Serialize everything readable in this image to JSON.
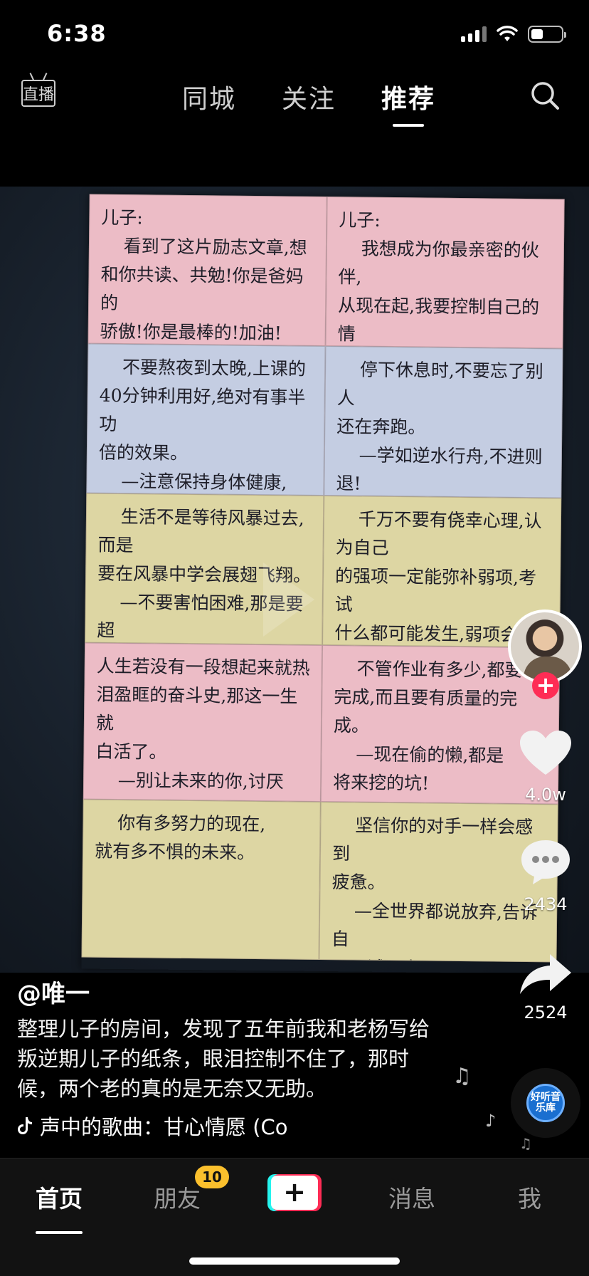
{
  "status_bar": {
    "time": "6:38"
  },
  "top_nav": {
    "live_label": "直播",
    "tabs": [
      {
        "label": "同城",
        "active": false
      },
      {
        "label": "关注",
        "active": false
      },
      {
        "label": "推荐",
        "active": true
      }
    ]
  },
  "video": {
    "notes": [
      {
        "text": "儿子:\n    看到了这片励志文章,想\n和你共读、共勉!你是爸妈的\n骄傲!你是最棒的!加油!"
      },
      {
        "text": "儿子:\n    我想成为你最亲密的伙伴,\n从现在起,我要控制自己的情\n绪,和你一起安静和平的处理\n好每一个当下。"
      },
      {
        "text": "    不要熬夜到太晚,上课的\n40分钟利用好,绝对有事半功\n倍的效果。\n    —注意保持身体健康,\n提高学习效率!"
      },
      {
        "text": "    停下休息时,不要忘了别人\n还在奔跑。\n    —学如逆水行舟,不进则\n退!"
      },
      {
        "text": "    生活不是等待风暴过去,而是\n要在风暴中学会展翅飞翔。\n    —不要害怕困难,那是要超\n越别人的机会!"
      },
      {
        "text": "    千万不要有侥幸心理,认为自己\n的强项一定能弥补弱项,考试\n什么都可能发生,弱项会使你来到\n失败!\n    —优秀和平庸的差距\n只在于一件事!"
      },
      {
        "text": "人生若没有一段想起来就热\n泪盈眶的奋斗史,那这一生就\n白活了。\n    —别让未来的你,讨厌\n现在的自己!"
      },
      {
        "text": "    不管作业有多少,都要\n完成,而且要有质量的完成。\n    —现在偷的懒,都是\n将来挖的坑!"
      },
      {
        "text": "    你有多努力的现在,\n就有多不惧的未来。"
      },
      {
        "text": "    坚信你的对手一样会感到\n疲惫。\n    —全世界都说放弃,告诉自\n己再试一次!"
      }
    ]
  },
  "actions": {
    "follow_symbol": "+",
    "likes": "4.0w",
    "comments": "2434",
    "shares": "2524"
  },
  "post": {
    "author": "@唯一",
    "caption": "整理儿子的房间，发现了五年前我和老杨写给叛逆期儿子的纸条，眼泪控制不住了，那时候，两个老的真的是无奈又无助。",
    "music": "声中的歌曲：甘心情愿 (Co",
    "disc_text": "好听音乐库"
  },
  "bottom_nav": {
    "items": [
      {
        "label": "首页",
        "active": true
      },
      {
        "label": "朋友",
        "active": false
      },
      {
        "label": "消息",
        "active": false
      },
      {
        "label": "我",
        "active": false
      }
    ],
    "friends_badge": "10",
    "create_symbol": "+"
  },
  "colors": {
    "accent_red": "#fe2c55",
    "accent_cyan": "#25f4ee",
    "badge_yellow": "#fbc02d",
    "note_pink": "#ecbcc6",
    "note_blue": "#c4cde2",
    "note_yellow": "#ddd6a3"
  },
  "icons": [
    "live-icon",
    "search-icon",
    "heart-icon",
    "comment-icon",
    "share-icon",
    "music-note-icon",
    "tiktok-logo-icon"
  ]
}
